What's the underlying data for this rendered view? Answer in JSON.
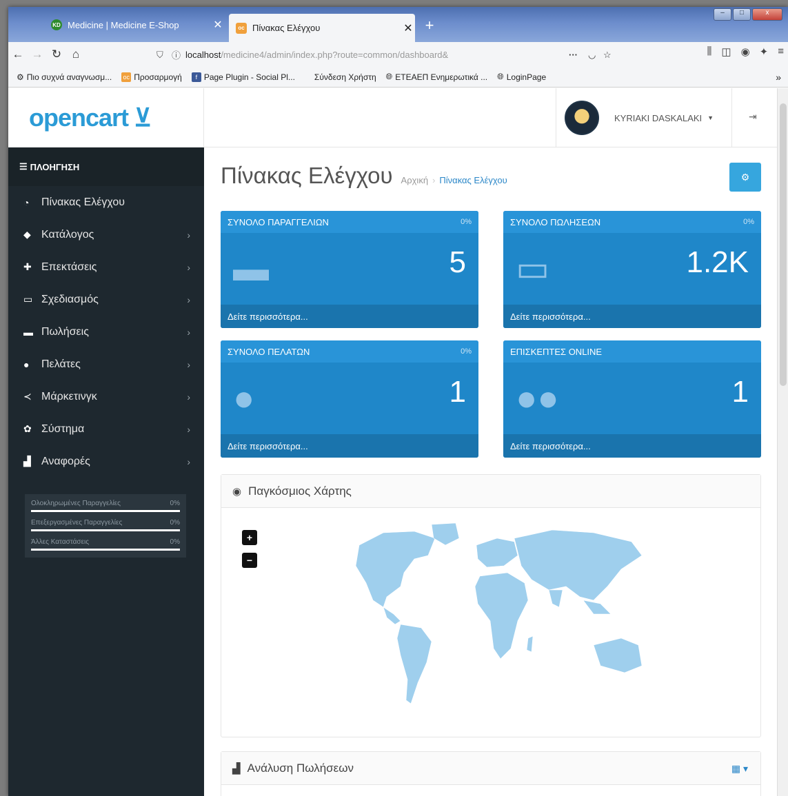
{
  "browser": {
    "tabs": [
      {
        "favicon": "KD",
        "title": "Medicine | Medicine E-Shop"
      },
      {
        "favicon": "oc",
        "title": "Πίνακας Ελέγχου"
      }
    ],
    "url_host": "localhost",
    "url_path": "/medicine4/admin/index.php?route=common/dashboard&",
    "bookmarks": [
      {
        "label": "Πιο συχνά αναγνωσμ...",
        "icon": "gear-icon"
      },
      {
        "label": "Προσαρμογή",
        "icon": "opencart-icon"
      },
      {
        "label": "Page Plugin - Social Pl...",
        "icon": "facebook-icon"
      },
      {
        "label": "Σύνδεση Χρήστη",
        "icon": ""
      },
      {
        "label": "ΕΤΕΑΕΠ Ενημερωτικά ...",
        "icon": "globe-icon"
      },
      {
        "label": "LoginPage",
        "icon": "globe-icon"
      }
    ]
  },
  "header": {
    "logo": "opencart",
    "user_name": "KYRIAKI DASKALAKI"
  },
  "sidebar": {
    "heading": "ΠΛΟΗΓΗΣΗ",
    "items": [
      {
        "label": "Πίνακας Ελέγχου",
        "icon": "dashboard-icon",
        "chevron": ""
      },
      {
        "label": "Κατάλογος",
        "icon": "tag-icon",
        "chevron": "›"
      },
      {
        "label": "Επεκτάσεις",
        "icon": "puzzle-icon",
        "chevron": "›"
      },
      {
        "label": "Σχεδιασμός",
        "icon": "monitor-icon",
        "chevron": "›"
      },
      {
        "label": "Πωλήσεις",
        "icon": "cart-icon",
        "chevron": "›"
      },
      {
        "label": "Πελάτες",
        "icon": "user-icon",
        "chevron": "›"
      },
      {
        "label": "Μάρκετινγκ",
        "icon": "share-icon",
        "chevron": "›"
      },
      {
        "label": "Σύστημα",
        "icon": "gear-icon",
        "chevron": "›"
      },
      {
        "label": "Αναφορές",
        "icon": "bar-chart-icon",
        "chevron": "›"
      }
    ],
    "stats": [
      {
        "label": "Ολοκληρωμένες Παραγγελίες",
        "value": "0%"
      },
      {
        "label": "Επεξεργασμένες Παραγγελίες",
        "value": "0%"
      },
      {
        "label": "Άλλες Καταστάσεις",
        "value": "0%"
      }
    ]
  },
  "main": {
    "title": "Πίνακας Ελέγχου",
    "breadcrumb": [
      "Αρχική",
      "Πίνακας Ελέγχου"
    ],
    "tiles": [
      {
        "title": "ΣΥΝΟΛΟ ΠΑΡΑΓΓΕΛΙΩΝ",
        "percent": "0%",
        "value": "5",
        "footer": "Δείτε περισσότερα...",
        "icon": "cart-icon"
      },
      {
        "title": "ΣΥΝΟΛΟ ΠΩΛΗΣΕΩΝ",
        "percent": "0%",
        "value": "1.2K",
        "footer": "Δείτε περισσότερα...",
        "icon": "credit-card-icon"
      },
      {
        "title": "ΣΥΝΟΛΟ ΠΕΛΑΤΩΝ",
        "percent": "0%",
        "value": "1",
        "footer": "Δείτε περισσότερα...",
        "icon": "user-icon"
      },
      {
        "title": "ΕΠΙΣΚΕΠΤΕΣ ONLINE",
        "percent": "",
        "value": "1",
        "footer": "Δείτε περισσότερα...",
        "icon": "users-icon"
      }
    ],
    "map_title": "Παγκόσμιος Χάρτης",
    "map_zoom_in": "+",
    "map_zoom_out": "−",
    "sales_title": "Ανάλυση Πωλήσεων"
  },
  "colors": {
    "accent": "#1f87c9",
    "sidebar": "#1e282f",
    "map_land": "#9fcfed"
  }
}
